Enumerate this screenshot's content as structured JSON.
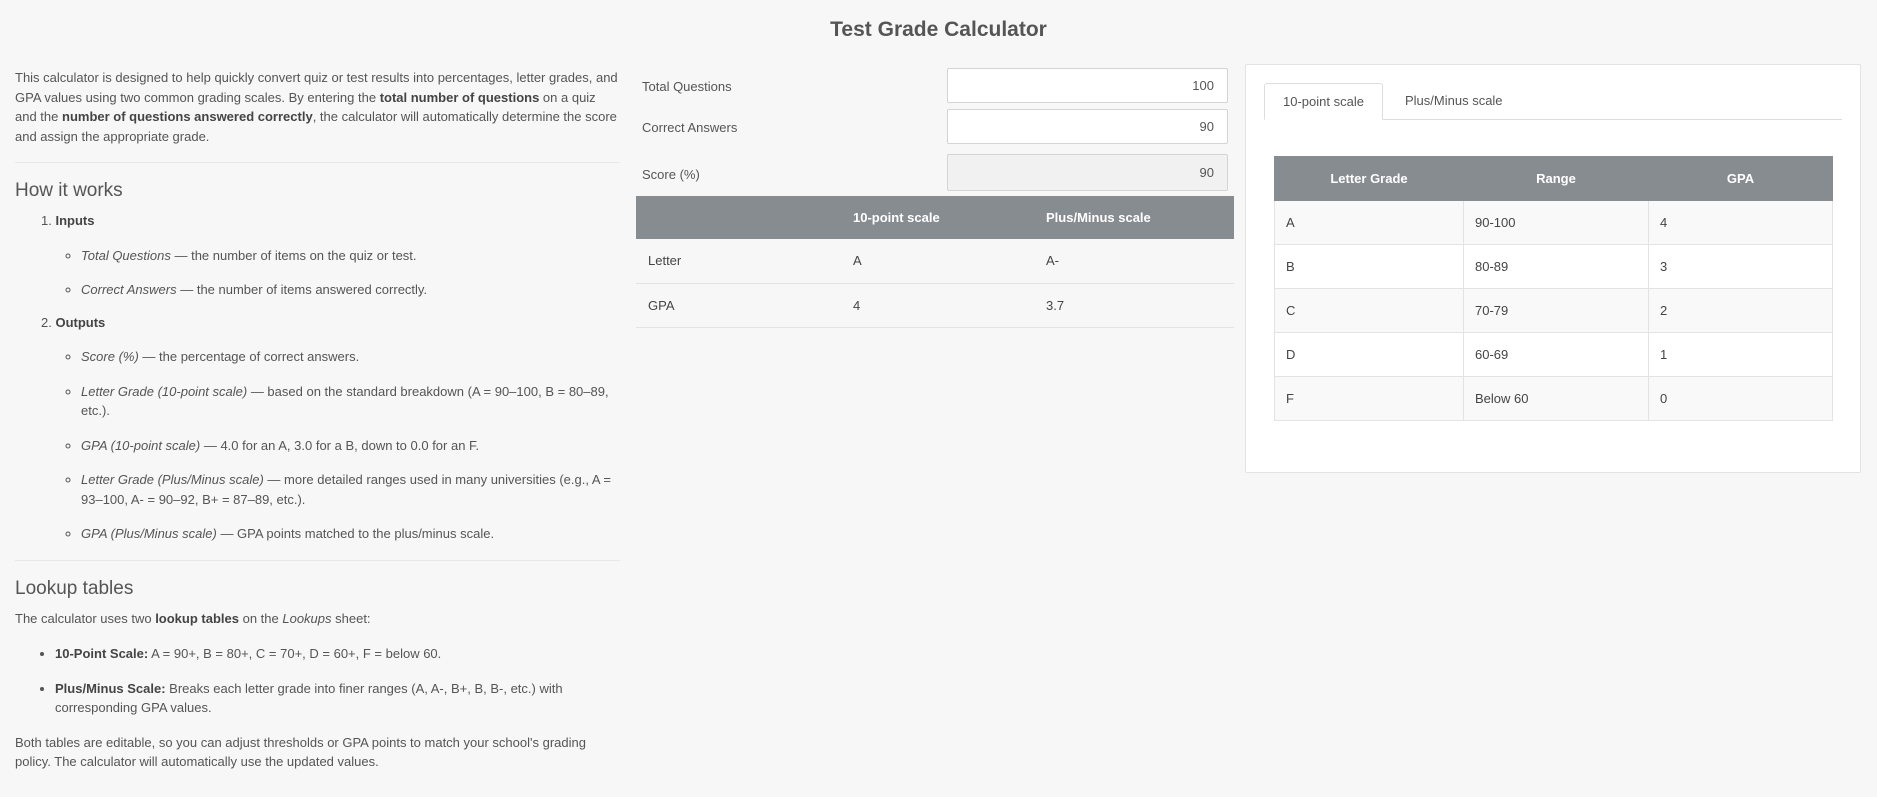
{
  "page_title": "Test Grade Calculator",
  "intro": {
    "t1": "This calculator is designed to help quickly convert quiz or test results into percentages, letter grades, and GPA values using two common grading scales. By entering the ",
    "b1": "total number of questions",
    "t2": " on a quiz and the ",
    "b2": "number of questions answered correctly",
    "t3": ", the calculator will automatically determine the score and assign the appropriate grade."
  },
  "how_it_works": {
    "heading": "How it works",
    "step1": {
      "number": "1.",
      "title": "Inputs",
      "items": [
        {
          "term": "Total Questions",
          "desc": " — the number of items on the quiz or test."
        },
        {
          "term": "Correct Answers",
          "desc": " — the number of items answered correctly."
        }
      ]
    },
    "step2": {
      "number": "2.",
      "title": "Outputs",
      "items": [
        {
          "term": "Score (%)",
          "desc": " — the percentage of correct answers."
        },
        {
          "term": "Letter Grade (10-point scale)",
          "desc": " — based on the standard breakdown (A = 90–100, B = 80–89, etc.)."
        },
        {
          "term": "GPA (10-point scale)",
          "desc": " — 4.0 for an A, 3.0 for a B, down to 0.0 for an F."
        },
        {
          "term": "Letter Grade (Plus/Minus scale)",
          "desc": " — more detailed ranges used in many universities (e.g., A = 93–100, A- = 90–92, B+ = 87–89, etc.)."
        },
        {
          "term": "GPA (Plus/Minus scale)",
          "desc": " — GPA points matched to the plus/minus scale."
        }
      ]
    }
  },
  "lookup_section": {
    "heading": "Lookup tables",
    "intro_t1": "The calculator uses two ",
    "intro_b": "lookup tables",
    "intro_t2": " on the ",
    "intro_i": "Lookups",
    "intro_t3": " sheet:",
    "bullets": [
      {
        "term": "10-Point Scale:",
        "desc": " A = 90+, B = 80+, C = 70+, D = 60+, F = below 60."
      },
      {
        "term": "Plus/Minus Scale:",
        "desc": " Breaks each letter grade into finer ranges (A, A-, B+, B, B-, etc.) with corresponding GPA values."
      }
    ],
    "footer": "Both tables are editable, so you can adjust thresholds or GPA points to match your school's grading policy. The calculator will automatically use the updated values."
  },
  "form": {
    "total_questions_label": "Total Questions",
    "total_questions_value": "100",
    "correct_answers_label": "Correct Answers",
    "correct_answers_value": "90",
    "score_label": "Score (%)",
    "score_value": "90"
  },
  "results": {
    "headers": [
      "",
      "10-point scale",
      "Plus/Minus scale"
    ],
    "rows": [
      [
        "Letter",
        "A",
        "A-"
      ],
      [
        "GPA",
        "4",
        "3.7"
      ]
    ]
  },
  "panel": {
    "tabs": [
      "10-point scale",
      "Plus/Minus scale"
    ],
    "active_tab": "10-point scale",
    "table_headers": [
      "Letter Grade",
      "Range",
      "GPA"
    ],
    "rows": [
      [
        "A",
        "90-100",
        "4"
      ],
      [
        "B",
        "80-89",
        "3"
      ],
      [
        "C",
        "70-79",
        "2"
      ],
      [
        "D",
        "60-69",
        "1"
      ],
      [
        "F",
        "Below 60",
        "0"
      ]
    ]
  }
}
